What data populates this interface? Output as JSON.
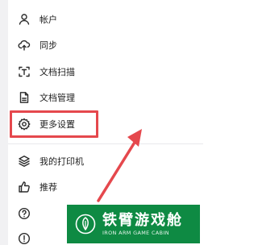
{
  "menu": {
    "items": [
      {
        "label": "帐户",
        "icon": "user-icon"
      },
      {
        "label": "同步",
        "icon": "cloud-sync-icon"
      },
      {
        "label": "文档扫描",
        "icon": "scan-text-icon"
      },
      {
        "label": "文档管理",
        "icon": "document-icon"
      },
      {
        "label": "更多设置",
        "icon": "gear-icon"
      },
      {
        "label": "我的打印机",
        "icon": "layers-icon"
      },
      {
        "label": "推荐",
        "icon": "thumbs-up-icon"
      },
      {
        "label": "",
        "icon": "help-circle-icon"
      },
      {
        "label": "",
        "icon": "info-circle-icon"
      }
    ]
  },
  "highlight": {
    "color": "#e5484d",
    "target": "更多设置"
  },
  "watermark": {
    "title": "铁臂游戏舱",
    "subtitle": "IRON ARM GAME CABIN",
    "background": "#0e8a43"
  }
}
